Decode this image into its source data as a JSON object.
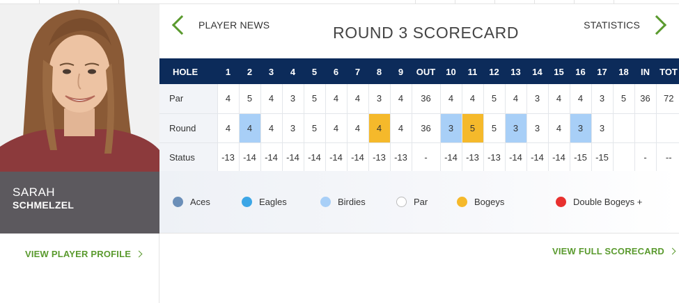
{
  "player": {
    "first_name": "SARAH",
    "last_name": "SCHMELZEL",
    "profile_link": "VIEW PLAYER PROFILE"
  },
  "header": {
    "prev_label": "PLAYER NEWS",
    "title": "ROUND 3 SCORECARD",
    "next_label": "STATISTICS"
  },
  "table": {
    "headers": [
      "HOLE",
      "1",
      "2",
      "3",
      "4",
      "5",
      "6",
      "7",
      "8",
      "9",
      "OUT",
      "10",
      "11",
      "12",
      "13",
      "14",
      "15",
      "16",
      "17",
      "18",
      "IN",
      "TOT"
    ],
    "rows": [
      {
        "label": "Par",
        "cells": [
          "4",
          "5",
          "4",
          "3",
          "5",
          "4",
          "4",
          "3",
          "4",
          "36",
          "4",
          "4",
          "5",
          "4",
          "3",
          "4",
          "4",
          "3",
          "5",
          "36",
          "72"
        ]
      },
      {
        "label": "Round",
        "cells": [
          "4",
          "4",
          "4",
          "3",
          "5",
          "4",
          "4",
          "4",
          "4",
          "36",
          "3",
          "5",
          "5",
          "3",
          "3",
          "4",
          "3",
          "3",
          "",
          "",
          ""
        ]
      },
      {
        "label": "Status",
        "cells": [
          "-13",
          "-14",
          "-14",
          "-14",
          "-14",
          "-14",
          "-14",
          "-13",
          "-13",
          "-",
          "-14",
          "-13",
          "-13",
          "-14",
          "-14",
          "-14",
          "-15",
          "-15",
          "",
          "-",
          "--"
        ]
      }
    ],
    "round_classes": [
      "",
      "birdie",
      "",
      "",
      "",
      "",
      "",
      "bogey",
      "",
      "",
      "birdie",
      "bogey",
      "",
      "birdie",
      "",
      "",
      "birdie",
      "",
      "",
      "",
      ""
    ]
  },
  "legend": [
    {
      "label": "Aces",
      "color": "#6b8fb8"
    },
    {
      "label": "Eagles",
      "color": "#3ca6e6"
    },
    {
      "label": "Birdies",
      "color": "#a8cff7"
    },
    {
      "label": "Par",
      "color": "#ffffff"
    },
    {
      "label": "Bogeys",
      "color": "#f5b92b"
    },
    {
      "label": "Double Bogeys +",
      "color": "#e8312f"
    }
  ],
  "full_scorecard_link": "VIEW FULL SCORECARD",
  "colors": {
    "accent_green": "#5a9a2e",
    "header_navy": "#0c2b5a",
    "name_box": "#5c595e"
  }
}
